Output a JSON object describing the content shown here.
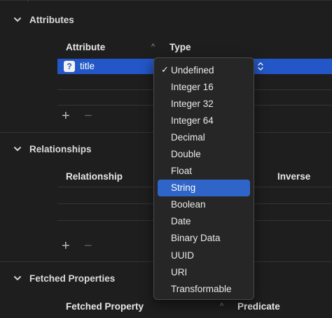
{
  "sections": {
    "attributes": {
      "title": "Attributes",
      "columns": [
        "Attribute",
        "Type"
      ],
      "selected_row": {
        "badge": "?",
        "name": "title"
      }
    },
    "relationships": {
      "title": "Relationships",
      "columns": [
        "Relationship",
        "Inverse"
      ]
    },
    "fetched_properties": {
      "title": "Fetched Properties",
      "columns": [
        "Fetched Property",
        "Predicate"
      ]
    }
  },
  "controls": {
    "add": "+",
    "remove": "−",
    "sort": "^"
  },
  "type_menu": {
    "checked": "Undefined",
    "highlighted": "String",
    "items": [
      "Undefined",
      "Integer 16",
      "Integer 32",
      "Integer 64",
      "Decimal",
      "Double",
      "Float",
      "String",
      "Boolean",
      "Date",
      "Binary Data",
      "UUID",
      "URI",
      "Transformable"
    ]
  },
  "colors": {
    "background": "#1e1e1e",
    "selection": "#2357c7",
    "menu_highlight": "#2f64c8"
  }
}
